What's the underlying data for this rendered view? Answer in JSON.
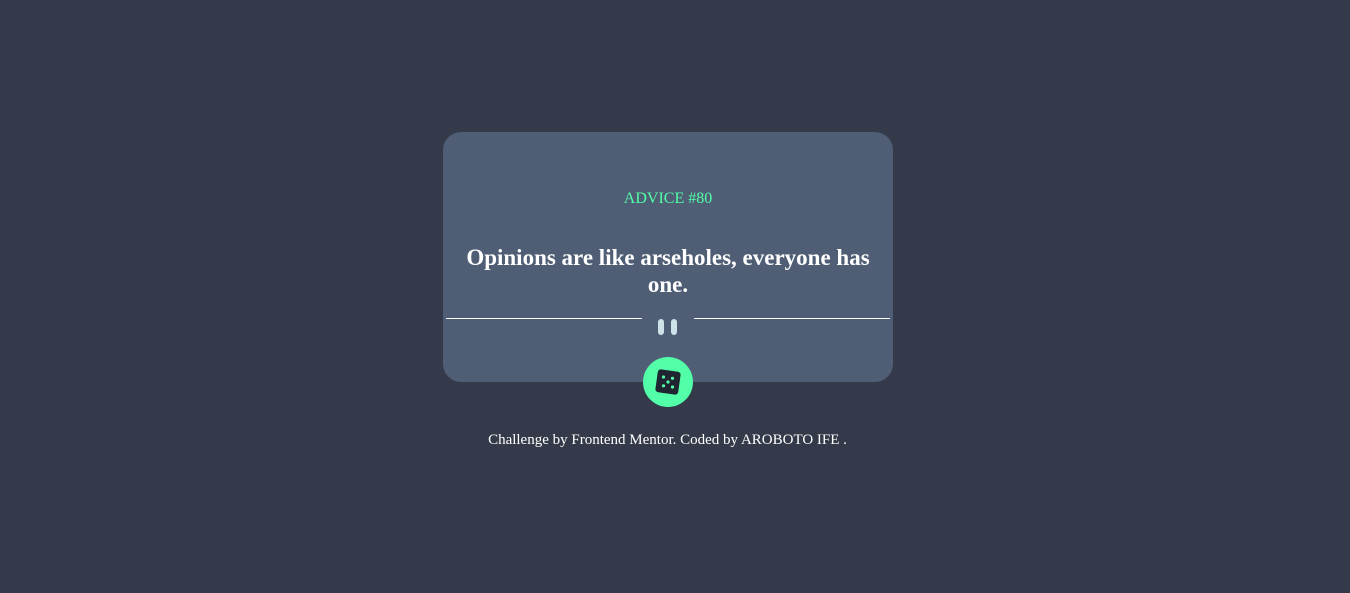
{
  "card": {
    "advice_label": "ADVICE #80",
    "advice_text": "Opinions are like arseholes, everyone has one."
  },
  "dice_button": {
    "icon": "dice-icon",
    "color": "#52ffa8"
  },
  "divider": {
    "icon": "pause-icon"
  },
  "footer": {
    "credit": "Challenge by Frontend Mentor. Coded by AROBOTO IFE ."
  },
  "colors": {
    "background": "#343a4a",
    "card": "#4f5d75",
    "accent": "#52ffa8",
    "text": "#ffffff"
  }
}
